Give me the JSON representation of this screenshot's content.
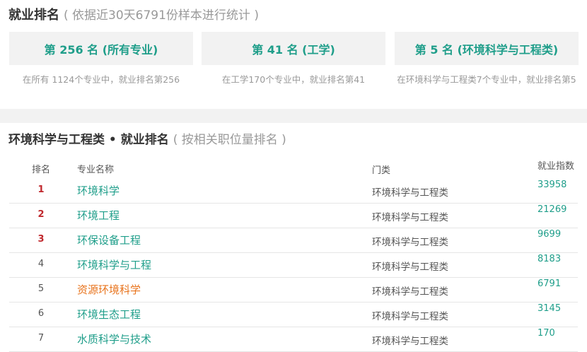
{
  "section1": {
    "title": "就业排名",
    "subtitle": "( 依据近30天6791份样本进行统计 )"
  },
  "rank_cards": [
    {
      "label": "第 256 名 (所有专业)",
      "desc": "在所有 1124个专业中，就业排名第256"
    },
    {
      "label": "第 41 名 (工学)",
      "desc": "在工学170个专业中，就业排名第41"
    },
    {
      "label": "第 5 名 (环境科学与工程类)",
      "desc": "在环境科学与工程类7个专业中，就业排名第5"
    }
  ],
  "section2": {
    "title": "环境科学与工程类 • 就业排名",
    "subtitle": "( 按相关职位量排名 )"
  },
  "table": {
    "headers": {
      "rank": "排名",
      "name": "专业名称",
      "category": "门类",
      "index": "就业指数"
    },
    "rows": [
      {
        "rank": "1",
        "name": "环境科学",
        "category": "环境科学与工程类",
        "index": "33958"
      },
      {
        "rank": "2",
        "name": "环境工程",
        "category": "环境科学与工程类",
        "index": "21269"
      },
      {
        "rank": "3",
        "name": "环保设备工程",
        "category": "环境科学与工程类",
        "index": "9699"
      },
      {
        "rank": "4",
        "name": "环境科学与工程",
        "category": "环境科学与工程类",
        "index": "8183"
      },
      {
        "rank": "5",
        "name": "资源环境科学",
        "category": "环境科学与工程类",
        "index": "6791"
      },
      {
        "rank": "6",
        "name": "环境生态工程",
        "category": "环境科学与工程类",
        "index": "3145"
      },
      {
        "rank": "7",
        "name": "水质科学与技术",
        "category": "环境科学与工程类",
        "index": "170"
      }
    ]
  },
  "colors": {
    "accent": "#1f9e8a",
    "top_rank": "#c0282d",
    "highlight": "#e8731c",
    "muted": "#999999"
  }
}
